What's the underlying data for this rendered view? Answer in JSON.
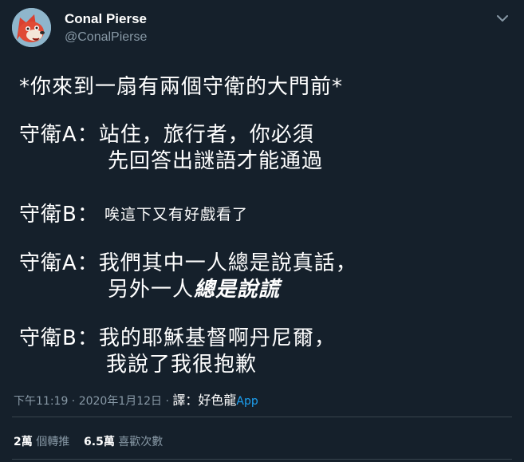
{
  "author": {
    "display_name": "Conal Pierse",
    "handle": "@ConalPierse",
    "avatar_icon": "red-fox-cartoon-avatar"
  },
  "menu_icon": "chevron-down-icon",
  "tweet": {
    "line1": "*你來到一扇有兩個守衛的大門前*",
    "line2": "守衛A：站住，旅行者，你必須",
    "line3": "先回答出謎語才能通過",
    "line4_speaker": "守衛B：",
    "line4_text": "唉這下又有好戲看了",
    "line5": "守衛A：我們其中一人總是說真話，",
    "line6_plain": "另外一人",
    "line6_emph": "總是說謊",
    "line7": "守衛B：我的耶穌基督啊丹尼爾，",
    "line8": "我說了我很抱歉"
  },
  "meta": {
    "timestamp": "下午11:19 · 2020年1月12日 · ",
    "caption": "譯：好色龍",
    "source_suffix": "App"
  },
  "stats": {
    "retweets_count": "2萬",
    "retweets_label": " 個轉推",
    "likes_count": "6.5萬",
    "likes_label": " 喜歡次數"
  },
  "colors": {
    "background": "#15202b",
    "secondary_text": "#8899a6",
    "link": "#1da1f2",
    "divider": "#38444d"
  }
}
